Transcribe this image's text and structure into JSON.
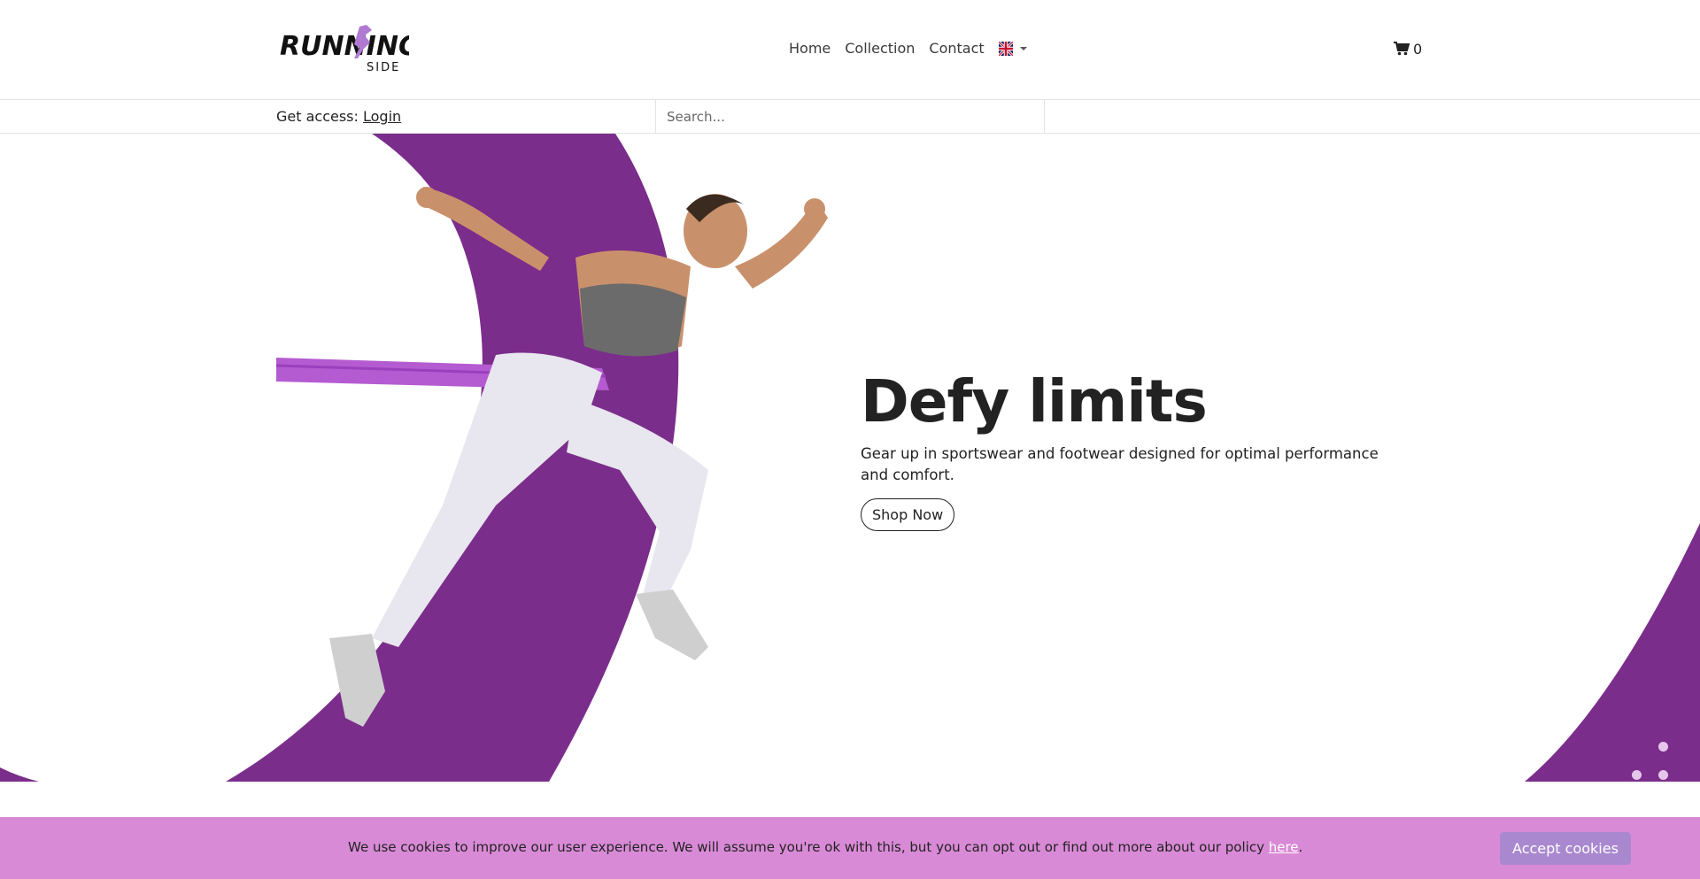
{
  "brand": {
    "logo_text_main": "RUNNING",
    "logo_text_sub": "SIDE",
    "accent_color": "#7b2d8b"
  },
  "nav": {
    "items": [
      {
        "label": "Home"
      },
      {
        "label": "Collection"
      },
      {
        "label": "Contact"
      }
    ],
    "language_icon": "uk-flag-icon"
  },
  "cart": {
    "icon": "cart-icon",
    "count": "0"
  },
  "subbar": {
    "access_label": "Get access:",
    "login_label": "Login",
    "search_placeholder": "Search..."
  },
  "hero": {
    "title": "Defy limits",
    "subtitle": "Gear up in sportswear and footwear designed for optimal performance and comfort.",
    "cta_label": "Shop Now",
    "image": "athlete-running-with-resistance-band"
  },
  "cookie": {
    "message": "We use cookies to improve our user experience. We will assume you're ok with this, but you can opt out or find out more about our policy ",
    "link_label": "here",
    "period": ".",
    "accept_label": "Accept cookies",
    "bar_color": "#d98ad6",
    "button_color": "#a988cf"
  }
}
